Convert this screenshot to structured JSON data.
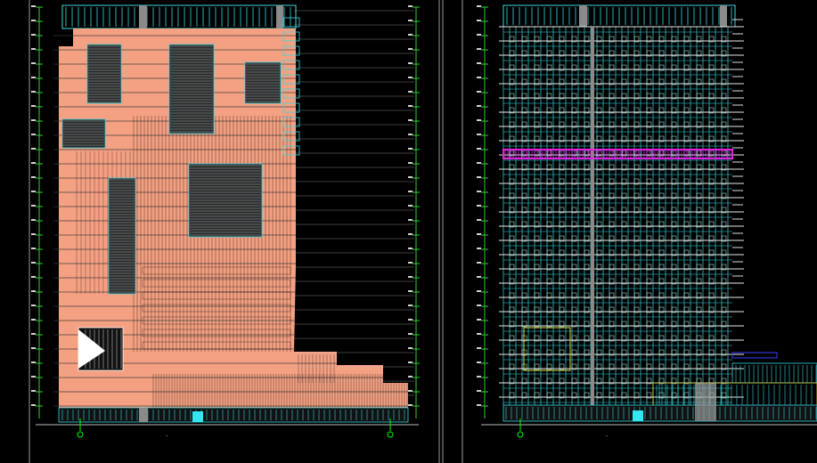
{
  "drawing": {
    "left_sheet": {
      "caption": "—"
    },
    "right_sheet": {
      "caption": "—"
    }
  },
  "colors": {
    "background": "#000000",
    "facade_fill": "#f4a082",
    "window_line": "#39d7e0",
    "dim_line": "#2fd02f",
    "slab_line": "#ffffff",
    "highlight_band": "#e022e0",
    "frame_line": "#8a8a8a",
    "grid_axis": "#00ff00",
    "accent_yellow": "#d8d83a",
    "accent_blue": "#3b3bff"
  },
  "icons": {
    "grid_axis_marker": "axis-bubble-icon"
  }
}
